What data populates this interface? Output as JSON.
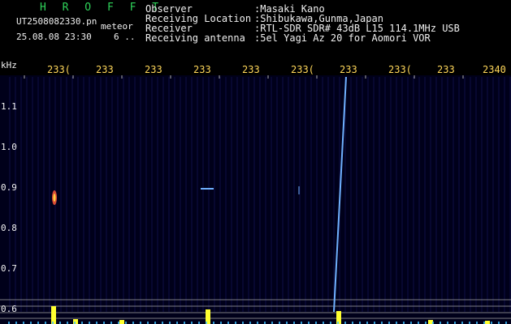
{
  "header": {
    "title": "H R O F F T",
    "filename": "UT2508082330.pn",
    "tag": "meteor",
    "timestamp": "25.08.08 23:30",
    "counter": "6 .."
  },
  "info": [
    {
      "label": "Observer",
      "value": ":Masaki Kano"
    },
    {
      "label": "Receiving Location",
      "value": ":Shibukawa,Gunma,Japan"
    },
    {
      "label": "Receiver",
      "value": ":RTL-SDR SDR# 43dB L15 114.1MHz USB"
    },
    {
      "label": "Receiving antenna",
      "value": ":5el Yagi Az 20 for Aomori VOR"
    }
  ],
  "axes": {
    "y_unit": "kHz",
    "x_ticks": [
      "233(",
      "233",
      "233",
      "233",
      "233",
      "233(",
      "233",
      "233(",
      "233",
      "2340"
    ],
    "y_ticks": [
      "1.1",
      "1.0",
      "0.9",
      "0.8",
      "0.7",
      "0.6"
    ]
  },
  "colors": {
    "background": "#00001a",
    "grid": "#1a1a6a",
    "signal": "#6fb0ff",
    "meteor": "#ff5a3a",
    "spectrum": "#ffff30",
    "guide": "#b0b0b0"
  }
}
